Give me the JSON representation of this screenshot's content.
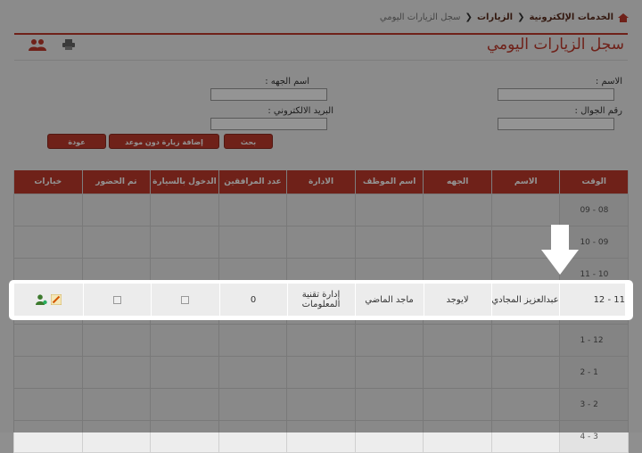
{
  "breadcrumb": {
    "home_icon": "home-icon",
    "items": [
      "الخدمات الإلكترونية",
      "الزيارات",
      "سجل الزيارات اليومي"
    ]
  },
  "page": {
    "title": "سجل الزيارات اليومي"
  },
  "form": {
    "name_label": "الاسم :",
    "entity_label": "اسم الجهه :",
    "mobile_label": "رقم الجوال :",
    "email_label": "البريد الالكتروني :",
    "name_value": "",
    "entity_value": "",
    "mobile_value": "",
    "email_value": ""
  },
  "buttons": {
    "search": "بحث",
    "add_visit": "إضافة زيارة دون موعد",
    "back": "عودة"
  },
  "table": {
    "headers": [
      "الوقت",
      "الاسم",
      "الجهه",
      "اسم الموظف",
      "الادارة",
      "عدد المرافقين",
      "الدخول بالسيارة",
      "تم الحضور",
      "خيارات"
    ],
    "time_slots": [
      "08 - 09",
      "09 - 10",
      "10 - 11",
      "11 - 12",
      "12 - 1",
      "1 - 2",
      "2 - 3",
      "3 - 4"
    ],
    "highlighted_row": {
      "time": "11 - 12",
      "name": "عبدالعزيز المجادي",
      "entity": "لايوجد",
      "employee": "ماجد الماضي",
      "department": "إدارة تقنية المعلومات",
      "companions": "0"
    }
  },
  "colors": {
    "accent": "#c0392b",
    "highlight": "#ffffff"
  }
}
